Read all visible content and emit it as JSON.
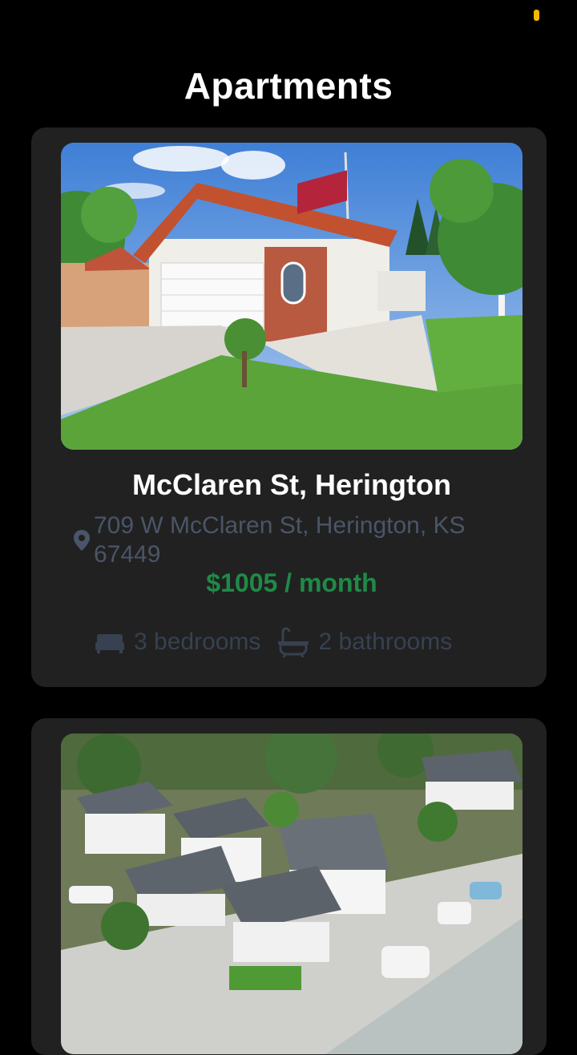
{
  "page": {
    "title": "Apartments"
  },
  "listings": [
    {
      "title": "McClaren St, Herington",
      "address": "709 W McClaren St, Herington, KS 67449",
      "price": "$1005 / month",
      "bedrooms": "3 bedrooms",
      "bathrooms": "2 bathrooms",
      "photo_icon": "house-photo"
    },
    {
      "photo_icon": "aerial-neighborhood-photo"
    }
  ],
  "colors": {
    "background": "#000000",
    "card": "#212121",
    "price": "#1f8a47",
    "muted_text": "#4a5568",
    "amenity_text": "#374151",
    "status_indicator": "#f5b800"
  }
}
